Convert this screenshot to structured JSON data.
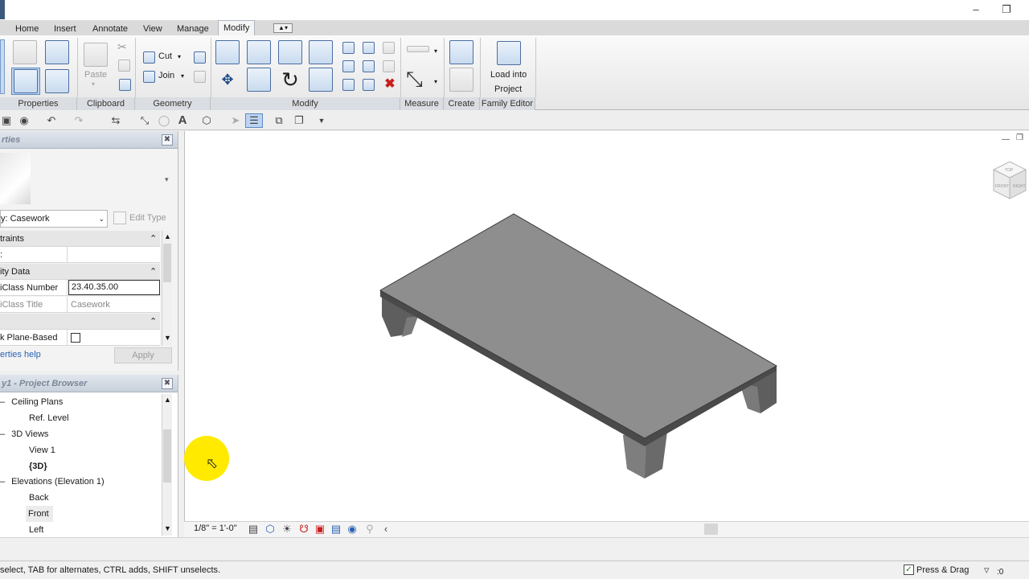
{
  "ribbon_tabs": [
    "Home",
    "Insert",
    "Annotate",
    "View",
    "Manage",
    "Modify"
  ],
  "active_tab": "Modify",
  "clipboard": {
    "paste": "Paste"
  },
  "geometry": {
    "cut": "Cut",
    "join": "Join"
  },
  "family_editor": {
    "load_line1": "Load into",
    "load_line2": "Project"
  },
  "panels": [
    "Properties",
    "Clipboard",
    "Geometry",
    "Modify",
    "Measure",
    "Create",
    "Family Editor"
  ],
  "properties": {
    "title": "rties",
    "type_selector": "y: Casework",
    "edit_type": "Edit Type",
    "groups": {
      "constraints": "traints",
      "identity": "ity Data",
      "other": ""
    },
    "rows": {
      "constraint_key": ":",
      "uniclass_number_key": "iClass Number",
      "uniclass_number_value": "23.40.35.00",
      "uniclass_title_key": "iClass Title",
      "uniclass_title_value": "Casework",
      "work_plane_key": "k Plane-Based"
    },
    "help": "erties help",
    "apply": "Apply"
  },
  "browser": {
    "title": "y1 - Project Browser",
    "items": [
      "Ceiling Plans",
      "Ref. Level",
      "3D Views",
      "View 1",
      "{3D}",
      "Elevations (Elevation 1)",
      "Back",
      "Front",
      "Left"
    ]
  },
  "viewbar": {
    "scale": "1/8\" = 1'-0\""
  },
  "status": {
    "hint": " select, TAB for alternates, CTRL adds, SHIFT unselects.",
    "press_drag": "Press & Drag",
    "filter_count": ":0"
  },
  "viewcube": {
    "top": "TOP",
    "front": "FRONT",
    "right": "RIGHT"
  },
  "colors": {
    "accent": "#3c6eb4",
    "table_top": "#8e8e8e",
    "cursor_highlight": "#ffea00"
  }
}
